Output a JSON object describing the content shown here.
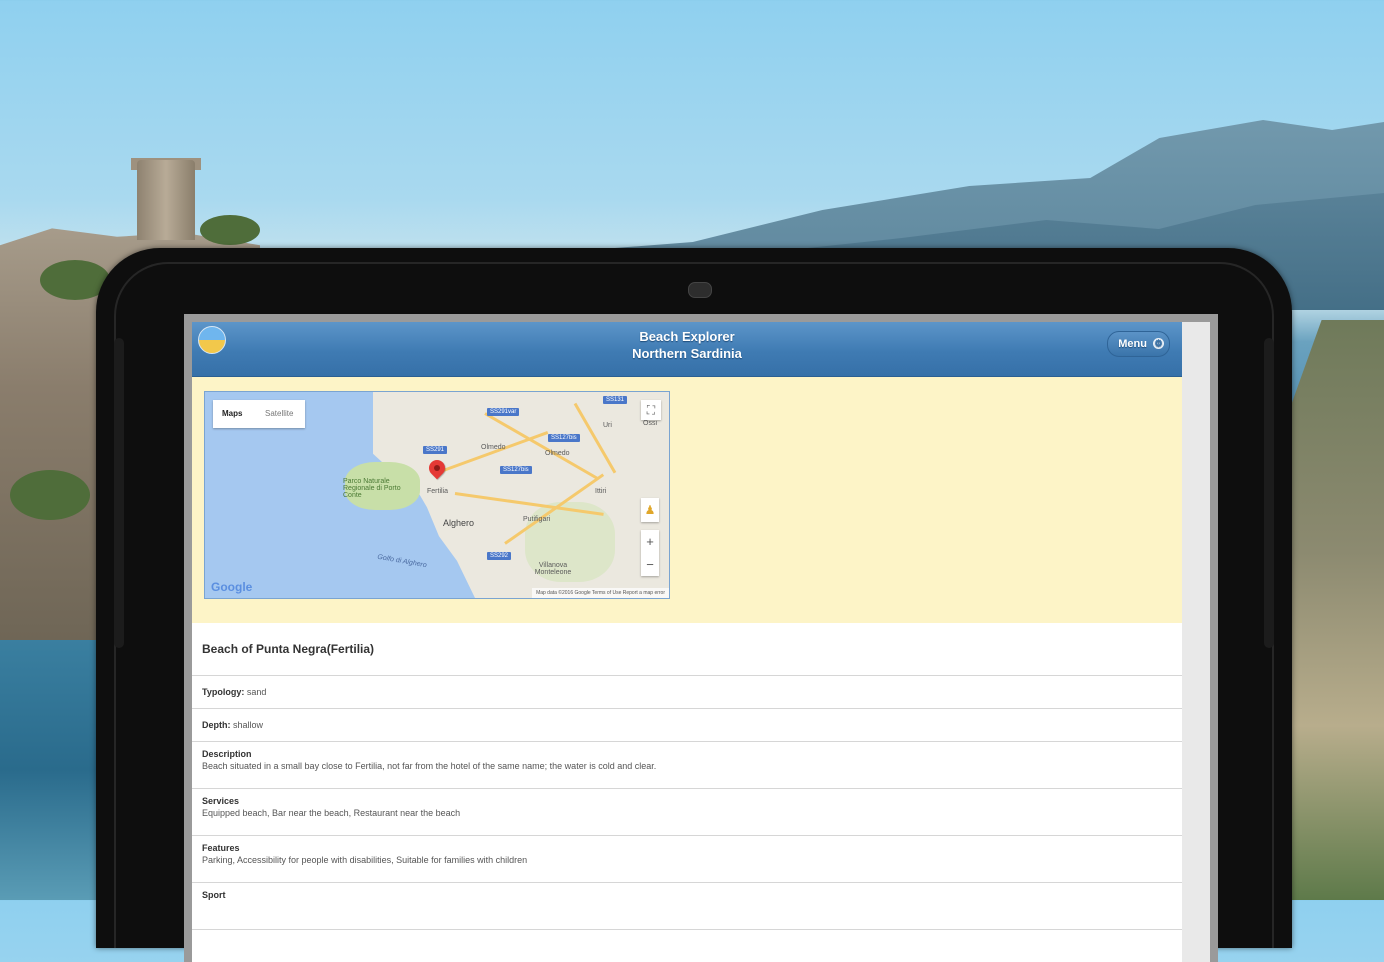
{
  "app": {
    "title_line1": "Beach Explorer",
    "title_line2": "Northern Sardinia",
    "menu_label": "Menu"
  },
  "map": {
    "map_type_map": "Maps",
    "map_type_satellite": "Satellite",
    "google": "Google",
    "attribution": "Map data ©2016 Google   Terms of Use   Report a map error",
    "labels": [
      "Parco Naturale Regionale di Porto Conte",
      "Fertilia",
      "Alghero",
      "Olmedo",
      "Olmedo",
      "Putifigari",
      "Villanova Monteleone",
      "Uri",
      "Ittiri",
      "Ossi",
      "Golfo di Alghero"
    ],
    "shields": [
      "SS291var",
      "SS291",
      "SS127bis",
      "SS127bis",
      "SS292",
      "SS131"
    ]
  },
  "beach": {
    "name": "Beach of Punta Negra(Fertilia)",
    "typology_label": "Typology:",
    "typology_value": "sand",
    "depth_label": "Depth:",
    "depth_value": "shallow",
    "description_label": "Description",
    "description_value": "Beach situated in a small bay close to Fertilia, not far from the hotel of the same name; the water is cold and clear.",
    "services_label": "Services",
    "services_value": "Equipped beach, Bar near the beach, Restaurant near the beach",
    "features_label": "Features",
    "features_value": "Parking, Accessibility for people with disabilities, Suitable for families with children",
    "sport_label": "Sport"
  }
}
